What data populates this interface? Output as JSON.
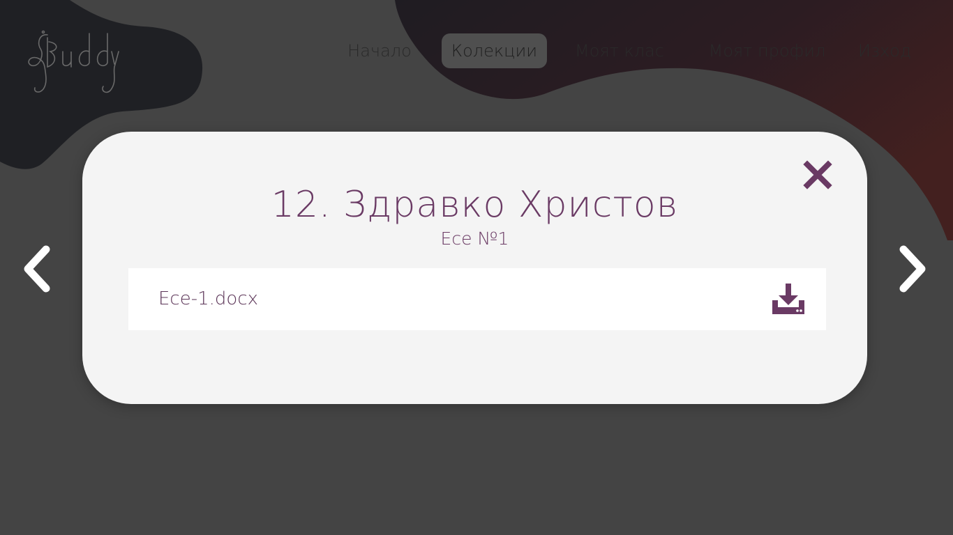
{
  "brand": {
    "logo_text": "Buddy",
    "logo_icon": "buddy-logo"
  },
  "nav": {
    "items": [
      {
        "label": "Начало",
        "active": false
      },
      {
        "label": "Колекции",
        "active": true
      },
      {
        "label": "Моят клас",
        "active": false
      },
      {
        "label": "Моят профил",
        "active": false
      },
      {
        "label": "Изход",
        "active": false
      }
    ]
  },
  "modal": {
    "title": "12. Здравко Христов",
    "subtitle": "Есе №1",
    "file": {
      "name": "Есе-1.docx",
      "action_icon": "download-icon"
    },
    "close_icon": "close-icon"
  },
  "carousel": {
    "prev_icon": "chevron-left-icon",
    "next_icon": "chevron-right-icon"
  },
  "colors": {
    "background": "#444444",
    "accent": "#6a3a64",
    "modal": "#f4f4f4",
    "blob_dark": "#1f2024",
    "blob_red": "#3e1d22"
  }
}
